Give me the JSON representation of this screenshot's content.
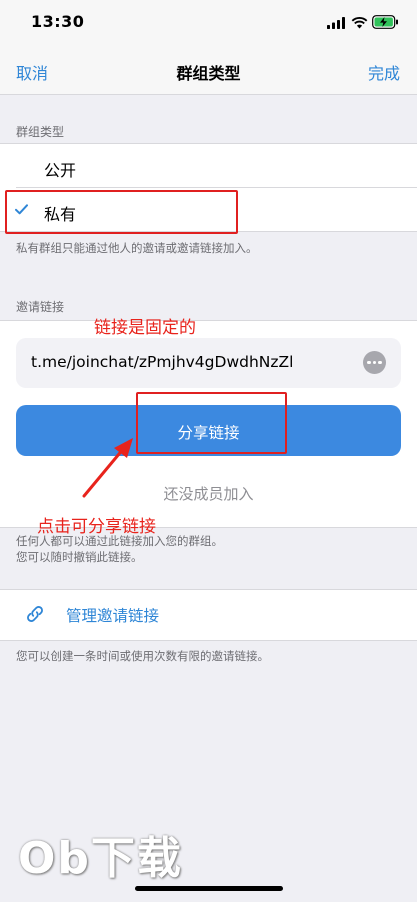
{
  "status_bar": {
    "time": "13:30"
  },
  "nav": {
    "cancel": "取消",
    "title": "群组类型",
    "done": "完成"
  },
  "group_type": {
    "header": "群组类型",
    "options": [
      {
        "label": "公开",
        "selected": false
      },
      {
        "label": "私有",
        "selected": true
      }
    ],
    "footnote": "私有群组只能通过他人的邀请或邀请链接加入。"
  },
  "invite": {
    "header": "邀请链接",
    "link": "t.me/joinchat/zPmjhv4gDwdhNzZl",
    "share_label": "分享链接",
    "no_members": "还没成员加入",
    "footnote_line1": "任何人都可以通过此链接加入您的群组。",
    "footnote_line2": "您可以随时撤销此链接。"
  },
  "manage": {
    "label": "管理邀请链接",
    "footnote": "您可以创建一条时间或使用次数有限的邀请链接。"
  },
  "annotations": {
    "fixed_link": "链接是固定的",
    "tap_to_share": "点击可分享链接",
    "color": "#e8231c"
  },
  "watermark": "Ob下载",
  "colors": {
    "accent": "#2f86d6",
    "button": "#3c89e0",
    "background": "#efeff4"
  }
}
